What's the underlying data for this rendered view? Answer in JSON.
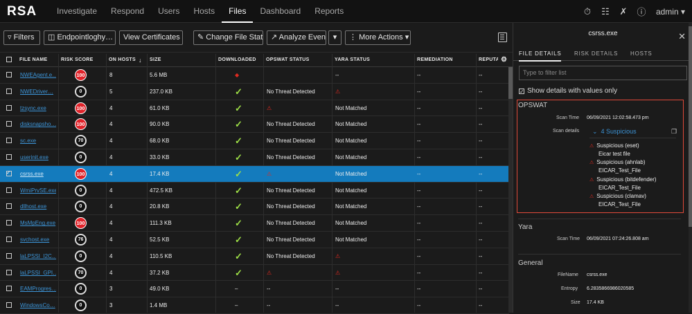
{
  "app": {
    "logo": "RSA",
    "nav": [
      "Investigate",
      "Respond",
      "Users",
      "Hosts",
      "Files",
      "Dashboard",
      "Reports"
    ],
    "active_nav": "Files",
    "user": "admin ▾"
  },
  "toolbar": {
    "filters": "Filters",
    "service": "Endpointloghy…",
    "view_certificates": "View Certificates",
    "change_status": "Change File Status",
    "analyze": "Analyze Events",
    "more_actions": "More Actions"
  },
  "table": {
    "headers": [
      "FILE NAME",
      "RISK SCORE",
      "ON HOSTS",
      "SIZE",
      "DOWNLOADED",
      "OPSWAT STATUS",
      "YARA STATUS",
      "REMEDIATION",
      "REPUTA"
    ],
    "sort_arrow": "↓",
    "rows": [
      {
        "name": "NWEAgent.e…",
        "risk": "100",
        "risk_type": "red",
        "hosts": "8",
        "size": "5.6 MB",
        "dl": "warn",
        "opswat": "",
        "opswat_icon": false,
        "yara": "--",
        "yara_icon": false,
        "rem": "--",
        "rep": "--",
        "sel": false
      },
      {
        "name": "NWEDriver…",
        "risk": "0",
        "risk_type": "blk",
        "hosts": "5",
        "size": "237.0 KB",
        "dl": "check",
        "opswat": "No Threat Detected",
        "opswat_icon": false,
        "yara": "",
        "yara_icon": true,
        "rem": "--",
        "rep": "--",
        "sel": false
      },
      {
        "name": "tzsync.exe",
        "risk": "100",
        "risk_type": "red",
        "hosts": "4",
        "size": "61.0 KB",
        "dl": "check",
        "opswat": "",
        "opswat_icon": true,
        "yara": "Not Matched",
        "yara_icon": false,
        "rem": "--",
        "rep": "--",
        "sel": false
      },
      {
        "name": "disksnapsho…",
        "risk": "100",
        "risk_type": "red",
        "hosts": "4",
        "size": "90.0 KB",
        "dl": "check",
        "opswat": "No Threat Detected",
        "opswat_icon": false,
        "yara": "Not Matched",
        "yara_icon": false,
        "rem": "--",
        "rep": "--",
        "sel": false
      },
      {
        "name": "sc.exe",
        "risk": "70",
        "risk_type": "blk",
        "hosts": "4",
        "size": "68.0 KB",
        "dl": "check",
        "opswat": "No Threat Detected",
        "opswat_icon": false,
        "yara": "Not Matched",
        "yara_icon": false,
        "rem": "--",
        "rep": "--",
        "sel": false
      },
      {
        "name": "userinit.exe",
        "risk": "0",
        "risk_type": "blk",
        "hosts": "4",
        "size": "33.0 KB",
        "dl": "check",
        "opswat": "No Threat Detected",
        "opswat_icon": false,
        "yara": "Not Matched",
        "yara_icon": false,
        "rem": "--",
        "rep": "--",
        "sel": false
      },
      {
        "name": "csrss.exe",
        "risk": "100",
        "risk_type": "red",
        "hosts": "4",
        "size": "17.4 KB",
        "dl": "check",
        "opswat": "",
        "opswat_icon": true,
        "yara": "Not Matched",
        "yara_icon": false,
        "rem": "--",
        "rep": "--",
        "sel": true
      },
      {
        "name": "WmiPrvSE.exe",
        "risk": "0",
        "risk_type": "blk",
        "hosts": "4",
        "size": "472.5 KB",
        "dl": "check",
        "opswat": "No Threat Detected",
        "opswat_icon": false,
        "yara": "Not Matched",
        "yara_icon": false,
        "rem": "--",
        "rep": "--",
        "sel": false
      },
      {
        "name": "dllhost.exe",
        "risk": "0",
        "risk_type": "blk",
        "hosts": "4",
        "size": "20.8 KB",
        "dl": "check",
        "opswat": "No Threat Detected",
        "opswat_icon": false,
        "yara": "Not Matched",
        "yara_icon": false,
        "rem": "--",
        "rep": "--",
        "sel": false
      },
      {
        "name": "MsMpEng.exe",
        "risk": "100",
        "risk_type": "red",
        "hosts": "4",
        "size": "111.3 KB",
        "dl": "check",
        "opswat": "No Threat Detected",
        "opswat_icon": false,
        "yara": "Not Matched",
        "yara_icon": false,
        "rem": "--",
        "rep": "--",
        "sel": false
      },
      {
        "name": "svchost.exe",
        "risk": "76",
        "risk_type": "blk",
        "hosts": "4",
        "size": "52.5 KB",
        "dl": "check",
        "opswat": "No Threat Detected",
        "opswat_icon": false,
        "yara": "Not Matched",
        "yara_icon": false,
        "rem": "--",
        "rep": "--",
        "sel": false
      },
      {
        "name": "laLPSSI_I2C…",
        "risk": "0",
        "risk_type": "blk",
        "hosts": "4",
        "size": "110.5 KB",
        "dl": "check",
        "opswat": "No Threat Detected",
        "opswat_icon": false,
        "yara": "",
        "yara_icon": true,
        "rem": "--",
        "rep": "--",
        "sel": false
      },
      {
        "name": "laLPSSI_GPI…",
        "risk": "70",
        "risk_type": "blk",
        "hosts": "4",
        "size": "37.2 KB",
        "dl": "check",
        "opswat": "",
        "opswat_icon": true,
        "yara": "",
        "yara_icon": true,
        "rem": "--",
        "rep": "--",
        "sel": false
      },
      {
        "name": "EAMProgres…",
        "risk": "0",
        "risk_type": "blk",
        "hosts": "3",
        "size": "49.0 KB",
        "dl": "dash",
        "opswat": "--",
        "opswat_icon": false,
        "yara": "--",
        "yara_icon": false,
        "rem": "--",
        "rep": "--",
        "sel": false
      },
      {
        "name": "WindowsCo…",
        "risk": "0",
        "risk_type": "blk",
        "hosts": "3",
        "size": "1.4 MB",
        "dl": "dash",
        "opswat": "--",
        "opswat_icon": false,
        "yara": "--",
        "yara_icon": false,
        "rem": "--",
        "rep": "--",
        "sel": false
      }
    ]
  },
  "panel": {
    "title": "csrss.exe",
    "tabs": [
      "FILE DETAILS",
      "RISK DETAILS",
      "HOSTS"
    ],
    "filter_placeholder": "Type to filter list",
    "show_label": "Show details with values only",
    "opswat": {
      "heading": "OPSWAT",
      "scan_time_label": "Scan Time",
      "scan_time": "06/09/2021 12:02:58.473 pm",
      "details_label": "Scan details",
      "details_summary": "4 Suspicious",
      "items": [
        {
          "status": "Suspicious (eset)",
          "name": "Eicar test file"
        },
        {
          "status": "Suspicious (ahnlab)",
          "name": "EICAR_Test_File"
        },
        {
          "status": "Suspicious (bitdefender)",
          "name": "EICAR_Test_File"
        },
        {
          "status": "Suspicious (clamav)",
          "name": "EICAR_Test_File"
        }
      ]
    },
    "yara": {
      "heading": "Yara",
      "scan_time_label": "Scan Time",
      "scan_time": "06/09/2021 07:24:26.808 am"
    },
    "general": {
      "heading": "General",
      "filename_label": "FileName",
      "filename": "csrss.exe",
      "entropy_label": "Entropy",
      "entropy": "6.2835866986020585",
      "size_label": "Size",
      "size": "17.4 KB"
    }
  },
  "colors": {
    "accent": "#147bbd",
    "danger": "#e0232a",
    "ok": "#9ee047",
    "link": "#3d95d8"
  }
}
